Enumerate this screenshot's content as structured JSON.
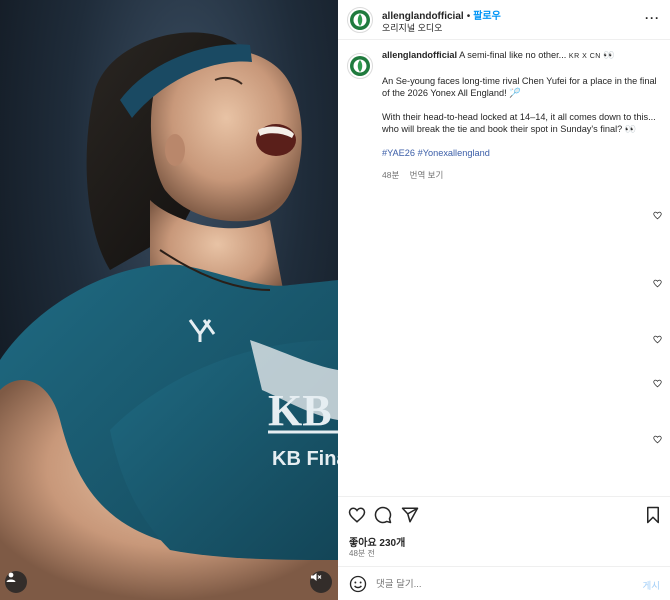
{
  "colors": {
    "accent": "#0095f6",
    "hashtag": "#3b5ea8",
    "jersey": "#1d5e73",
    "headband": "#1a4a63",
    "background": "#1f2c3a"
  },
  "media": {
    "jersey_logo": "KB",
    "jersey_text": "KB Finance",
    "user_tag_icon": "user-icon",
    "mute_icon": "speaker-muted-icon"
  },
  "header": {
    "username": "allenglandofficial",
    "separator": "•",
    "follow_label": "팔로우",
    "audio_label": "오리지널 오디오",
    "more_icon": "more-horizontal-icon",
    "more_label": "···"
  },
  "caption": {
    "username": "allenglandofficial",
    "line1_text": "A semi-final like no other...",
    "line1_suffix": "KR X CN",
    "line1_emoji": "👀",
    "paragraph2": "An Se-young faces long-time rival Chen Yufei for a place in the final of the 2026 Yonex All England! 🏸",
    "paragraph3": "With their head-to-head locked at 14–14, it all comes down to this... who will break the tie and book their spot in Sunday's final? 👀",
    "hashtag1": "#YAE26",
    "hashtag2": "#Yonexallengland",
    "time": "48분",
    "translate_label": "번역 보기"
  },
  "comment_likes": [
    {
      "icon": "heart-icon"
    },
    {
      "icon": "heart-icon"
    },
    {
      "icon": "heart-icon"
    },
    {
      "icon": "heart-icon"
    },
    {
      "icon": "heart-icon"
    }
  ],
  "actions": {
    "like_icon": "heart-icon",
    "comment_icon": "comment-icon",
    "share_icon": "share-icon",
    "save_icon": "bookmark-icon",
    "likes_label": "좋아요 230개",
    "post_time": "48분 전"
  },
  "comment_bar": {
    "emoji_icon": "emoji-icon",
    "placeholder": "댓글 달기...",
    "post_label": "게시"
  }
}
